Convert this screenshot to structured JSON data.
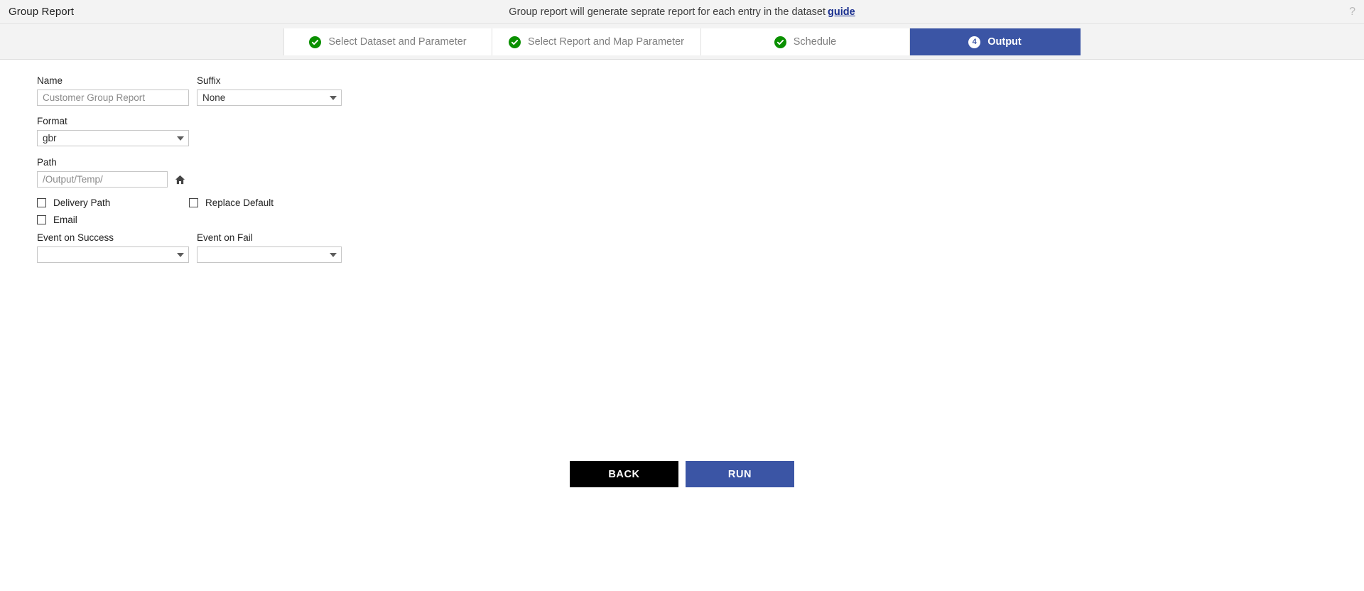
{
  "header": {
    "title": "Group Report",
    "description": "Group report will generate seprate report for each entry in the dataset",
    "guide_link": "guide",
    "help_icon": "?"
  },
  "stepper": {
    "steps": [
      {
        "label": "Select Dataset and Parameter",
        "state": "complete",
        "marker": "check-icon"
      },
      {
        "label": "Select Report and Map Parameter",
        "state": "complete",
        "marker": "check-icon"
      },
      {
        "label": "Schedule",
        "state": "complete",
        "marker": "check-icon"
      },
      {
        "label": "Output",
        "state": "active",
        "marker": "4"
      }
    ]
  },
  "form": {
    "name": {
      "label": "Name",
      "value": "Customer Group Report"
    },
    "suffix": {
      "label": "Suffix",
      "value": "None"
    },
    "format": {
      "label": "Format",
      "value": "gbr"
    },
    "path": {
      "label": "Path",
      "value": "/Output/Temp/",
      "home_icon": "home-icon"
    },
    "delivery_path": {
      "label": "Delivery Path",
      "checked": false
    },
    "replace_default": {
      "label": "Replace Default",
      "checked": false
    },
    "email": {
      "label": "Email",
      "checked": false
    },
    "event_on_success": {
      "label": "Event on Success",
      "value": ""
    },
    "event_on_fail": {
      "label": "Event on Fail",
      "value": ""
    }
  },
  "footer": {
    "back_label": "BACK",
    "run_label": "RUN"
  },
  "colors": {
    "accent": "#3b55a5",
    "success": "#0a9000",
    "link": "#1a2f8f",
    "back_button": "#000000"
  }
}
